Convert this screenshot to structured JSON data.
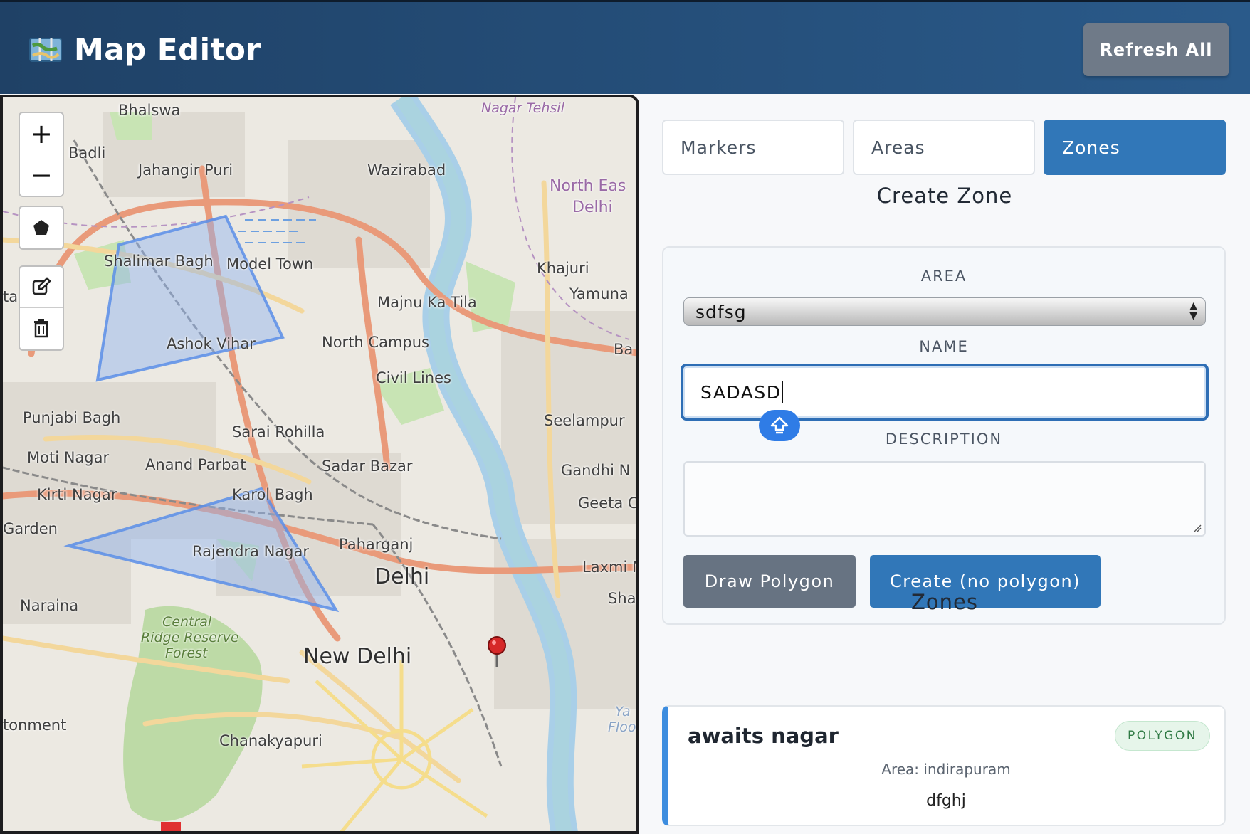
{
  "header": {
    "title": "Map Editor",
    "icon": "map-icon",
    "refresh_label": "Refresh All"
  },
  "map": {
    "controls": {
      "zoom_in": "+",
      "zoom_out": "−"
    },
    "labels": {
      "bhalswa": "Bhalswa",
      "nagar_tehsil": "Nagar Tehsil",
      "badli": "Badli",
      "jahangir_puri": "Jahangir Puri",
      "wazirabad": "Wazirabad",
      "north_east_1": "North Eas",
      "north_east_2": "Delhi",
      "shalimar_bagh": "Shalimar Bagh",
      "model_town": "Model Town",
      "khajuri": "Khajuri",
      "yamuna": "Yamuna",
      "majnu_ka_tila": "Majnu Ka Tila",
      "ashok_vihar": "Ashok Vihar",
      "north_campus": "North Campus",
      "ba": "Ba",
      "ta": "ta",
      "civil_lines": "Civil Lines",
      "punjabi_bagh": "Punjabi Bagh",
      "sarai_rohilla": "Sarai Rohilla",
      "seelampur": "Seelampur",
      "moti_nagar": "Moti Nagar",
      "anand_parbat": "Anand Parbat",
      "sadar_bazar": "Sadar Bazar",
      "gandhi_n": "Gandhi N",
      "kirti_nagar": "Kirti Nagar",
      "karol_bagh": "Karol Bagh",
      "geeta_c": "Geeta C",
      "garden": "Garden",
      "rajendra_nagar": "Rajendra Nagar",
      "paharganj": "Paharganj",
      "laxmi": "Laxmi N",
      "delhi": "Delhi",
      "sha": "Sha",
      "naraina": "Naraina",
      "central_ridge_1": "Central",
      "central_ridge_2": "Ridge Reserve",
      "central_ridge_3": "Forest",
      "new_delhi": "New Delhi",
      "ya": "Ya",
      "floo": "Floo",
      "tonment": "tonment",
      "chanakyapuri": "Chanakyapuri"
    }
  },
  "tabs": [
    {
      "label": "Markers",
      "active": false
    },
    {
      "label": "Areas",
      "active": false
    },
    {
      "label": "Zones",
      "active": true
    }
  ],
  "create_zone": {
    "title": "Create Zone",
    "area_label": "AREA",
    "area_value": "sdfsg",
    "name_label": "NAME",
    "name_value": "SADASD",
    "description_label": "DESCRIPTION",
    "description_value": "",
    "draw_button": "Draw Polygon",
    "create_button": "Create (no polygon)"
  },
  "zones": {
    "title": "Zones",
    "items": [
      {
        "name": "awaits nagar",
        "badge": "POLYGON",
        "area": "Area: indirapuram",
        "description": "dfghj"
      }
    ]
  },
  "colors": {
    "header_start": "#1f4166",
    "header_end": "#2a5a8a",
    "primary": "#3177b8",
    "secondary": "#677382",
    "zone_accent": "#3d8ddf",
    "polygon_fill": "#8fb1f0"
  }
}
